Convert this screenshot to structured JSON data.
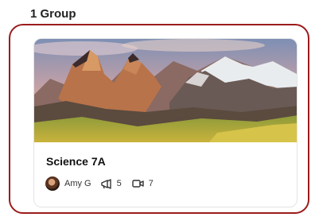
{
  "header": {
    "group_count": "1 Group"
  },
  "card": {
    "title": "Science 7A",
    "owner_name": "Amy G",
    "announcements_count": "5",
    "videos_count": "7",
    "cover_image": "mountain-landscape",
    "avatar": "profile-photo"
  },
  "icons": {
    "announcements": "megaphone-icon",
    "videos": "video-camera-icon"
  },
  "colors": {
    "selection_border": "#9b1c1c"
  }
}
